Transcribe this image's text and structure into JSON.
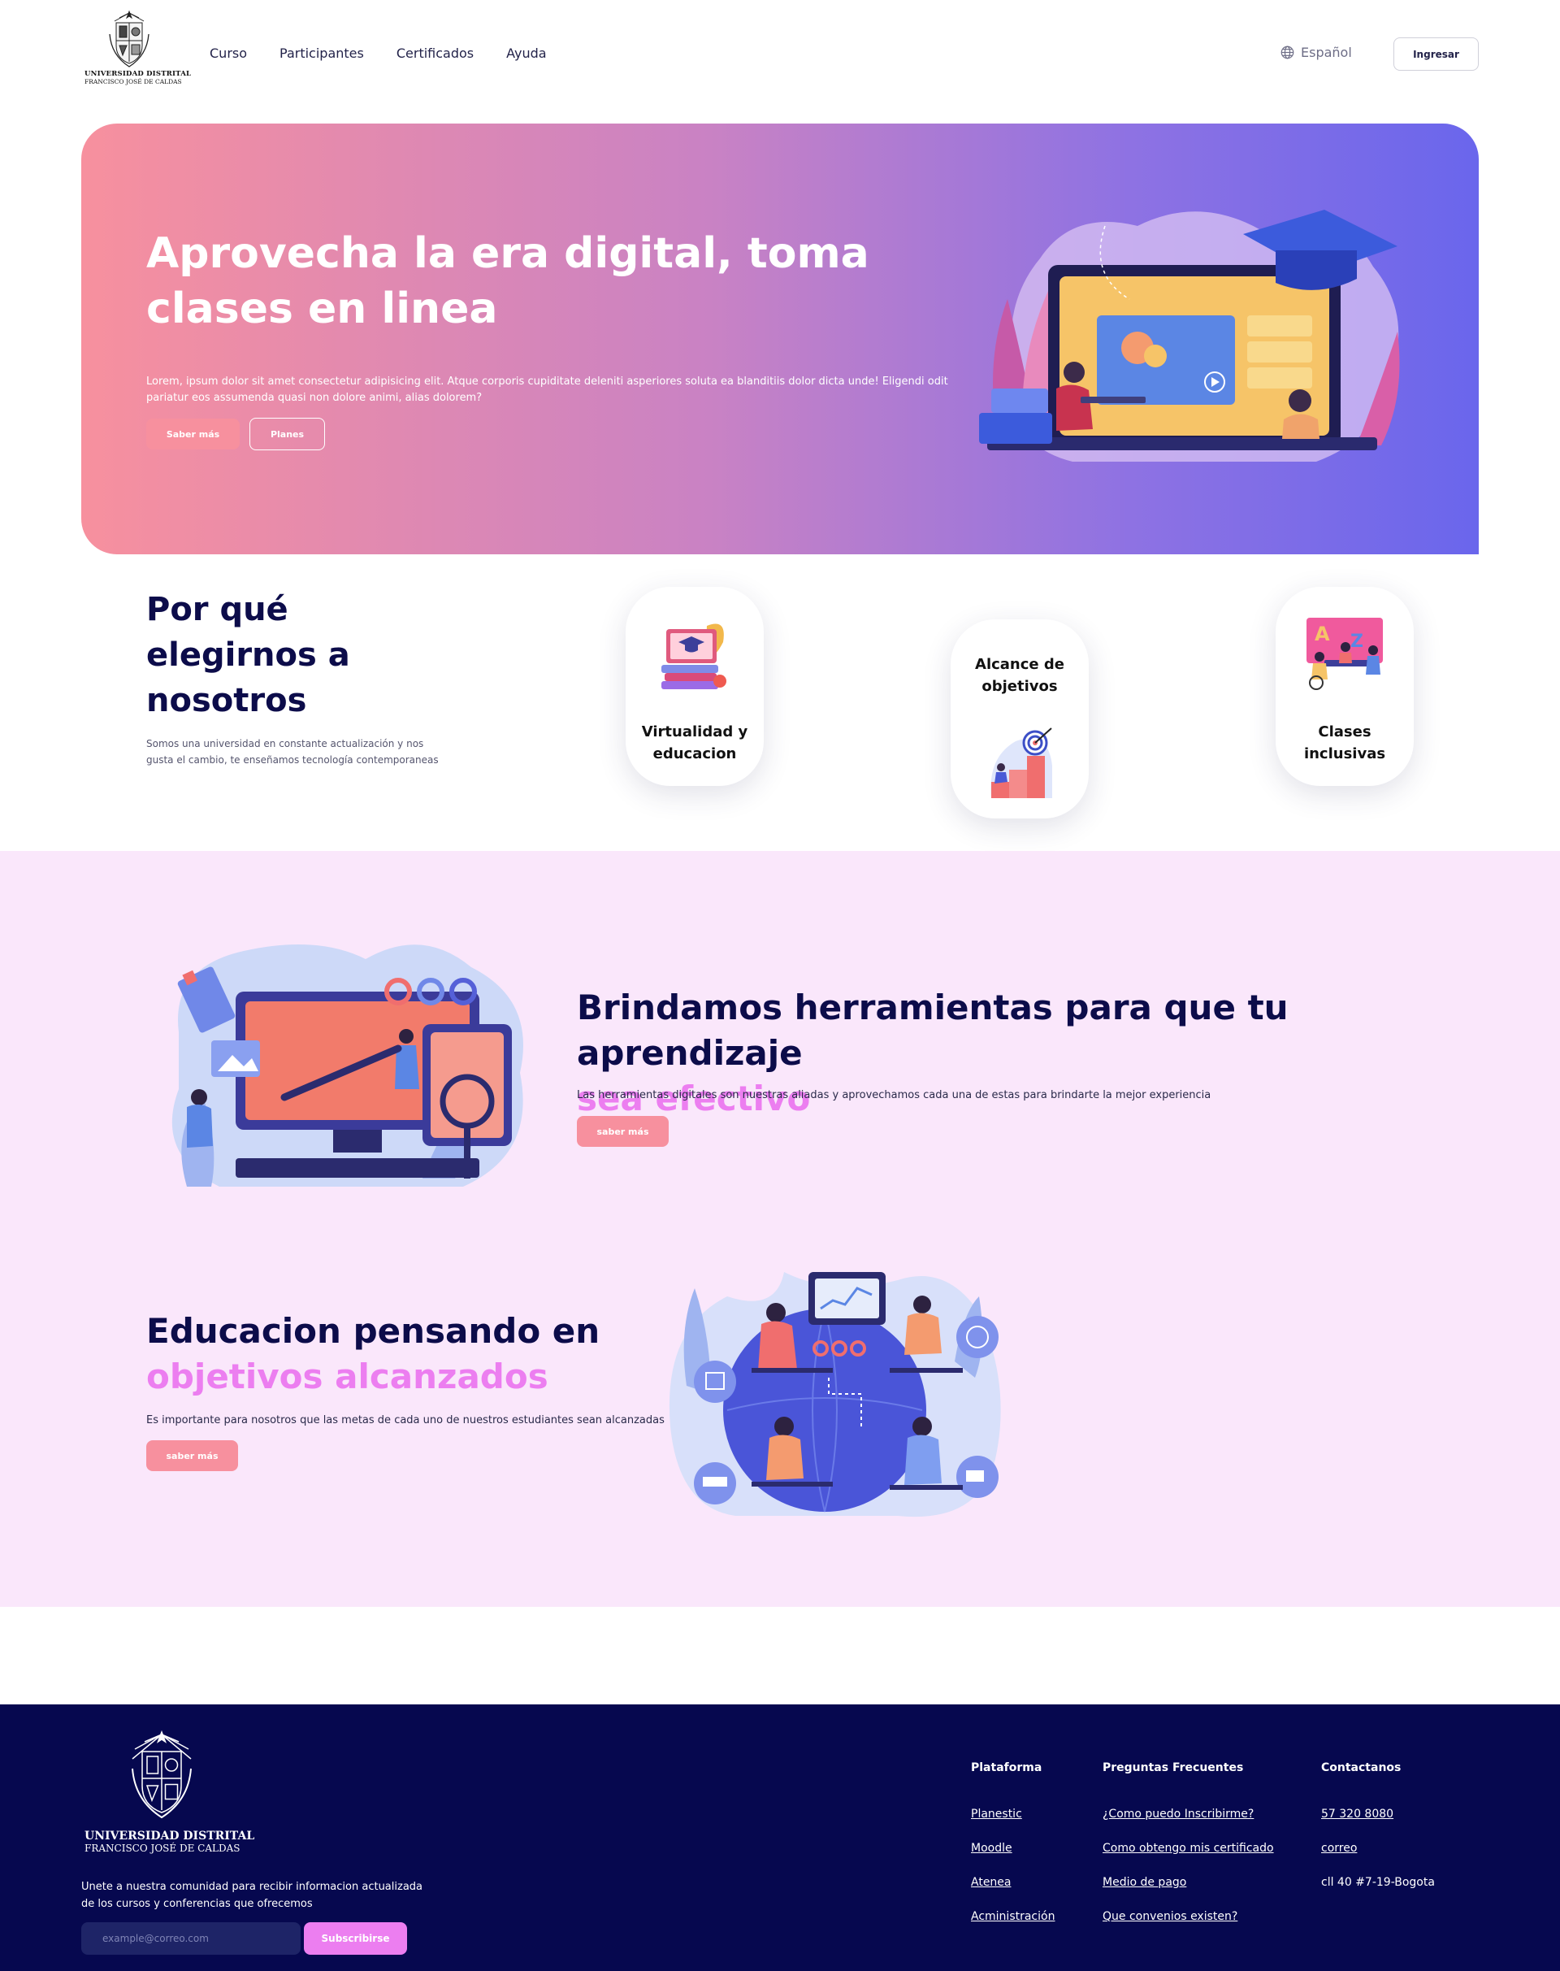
{
  "header": {
    "logo": {
      "line1": "UNIVERSIDAD DISTRITAL",
      "line2": "FRANCISCO JOSÉ DE CALDAS"
    },
    "nav": [
      "Curso",
      "Participantes",
      "Certificados",
      "Ayuda"
    ],
    "language": "Español",
    "login_label": "Ingresar",
    "icons": {
      "language": "globe-icon"
    }
  },
  "hero": {
    "title": "Aprovecha la era digital, toma clases en linea",
    "description": "Lorem, ipsum dolor sit amet consectetur adipisicing elit. Atque corporis cupiditate deleniti asperiores soluta ea blanditiis dolor dicta unde! Eligendi odit pariatur eos assumenda quasi non dolore animi, alias dolorem?",
    "primary_button": "Saber más",
    "secondary_button": "Planes"
  },
  "why": {
    "title": "Por qué elegirnos a nosotros",
    "description": "Somos una universidad en constante actualización y nos gusta el cambio, te enseñamos tecnología contemporaneas",
    "cards": [
      {
        "label": "Virtualidad y educacion",
        "icon": "laptop-books-icon"
      },
      {
        "label": "Alcance de objetivos",
        "icon": "target-icon"
      },
      {
        "label": "Clases inclusivas",
        "icon": "classroom-icon"
      }
    ]
  },
  "features": [
    {
      "title_main": "Brindamos herramientas para que tu aprendizaje",
      "title_accent": "sea efectivo",
      "description": "Las herramientas digitales son nuestras aliadas y aprovechamos cada una de estas para brindarte la mejor experiencia",
      "button": "saber más"
    },
    {
      "title_main": "Educacion pensando en",
      "title_accent": "objetivos alcanzados",
      "description": "Es importante para nosotros que las metas de cada uno de nuestros estudiantes sean alcanzadas",
      "button": "saber más"
    }
  ],
  "footer": {
    "logo": {
      "line1": "UNIVERSIDAD DISTRITAL",
      "line2": "FRANCISCO JOSÉ DE CALDAS"
    },
    "text": "Unete a nuestra comunidad para recibir informacion actualizada de los cursos y conferencias que ofrecemos",
    "email_placeholder": "example@correo.com",
    "subscribe_label": "Subscribirse",
    "columns": [
      {
        "title": "Plataforma",
        "links": [
          "Planestic",
          "Moodle",
          "Atenea",
          "Acministración"
        ]
      },
      {
        "title": "Preguntas Frecuentes",
        "links": [
          "¿Como puedo Inscribirme?",
          "Como obtengo mis certificado",
          "Medio de pago",
          "Que convenios existen?"
        ]
      },
      {
        "title": "Contactanos",
        "links": [
          "57 320 8080",
          "correo"
        ],
        "address": "cll 40 #7-19-Bogota"
      }
    ]
  },
  "colors": {
    "navy": "#0c0c4a",
    "footer_bg": "#06084f",
    "pink_button": "#f7909e",
    "accent_pink": "#ec7ef0",
    "section_bg": "#fae7fb",
    "hero_gradient_start": "#f7909e",
    "hero_gradient_end": "#6a66ec"
  }
}
